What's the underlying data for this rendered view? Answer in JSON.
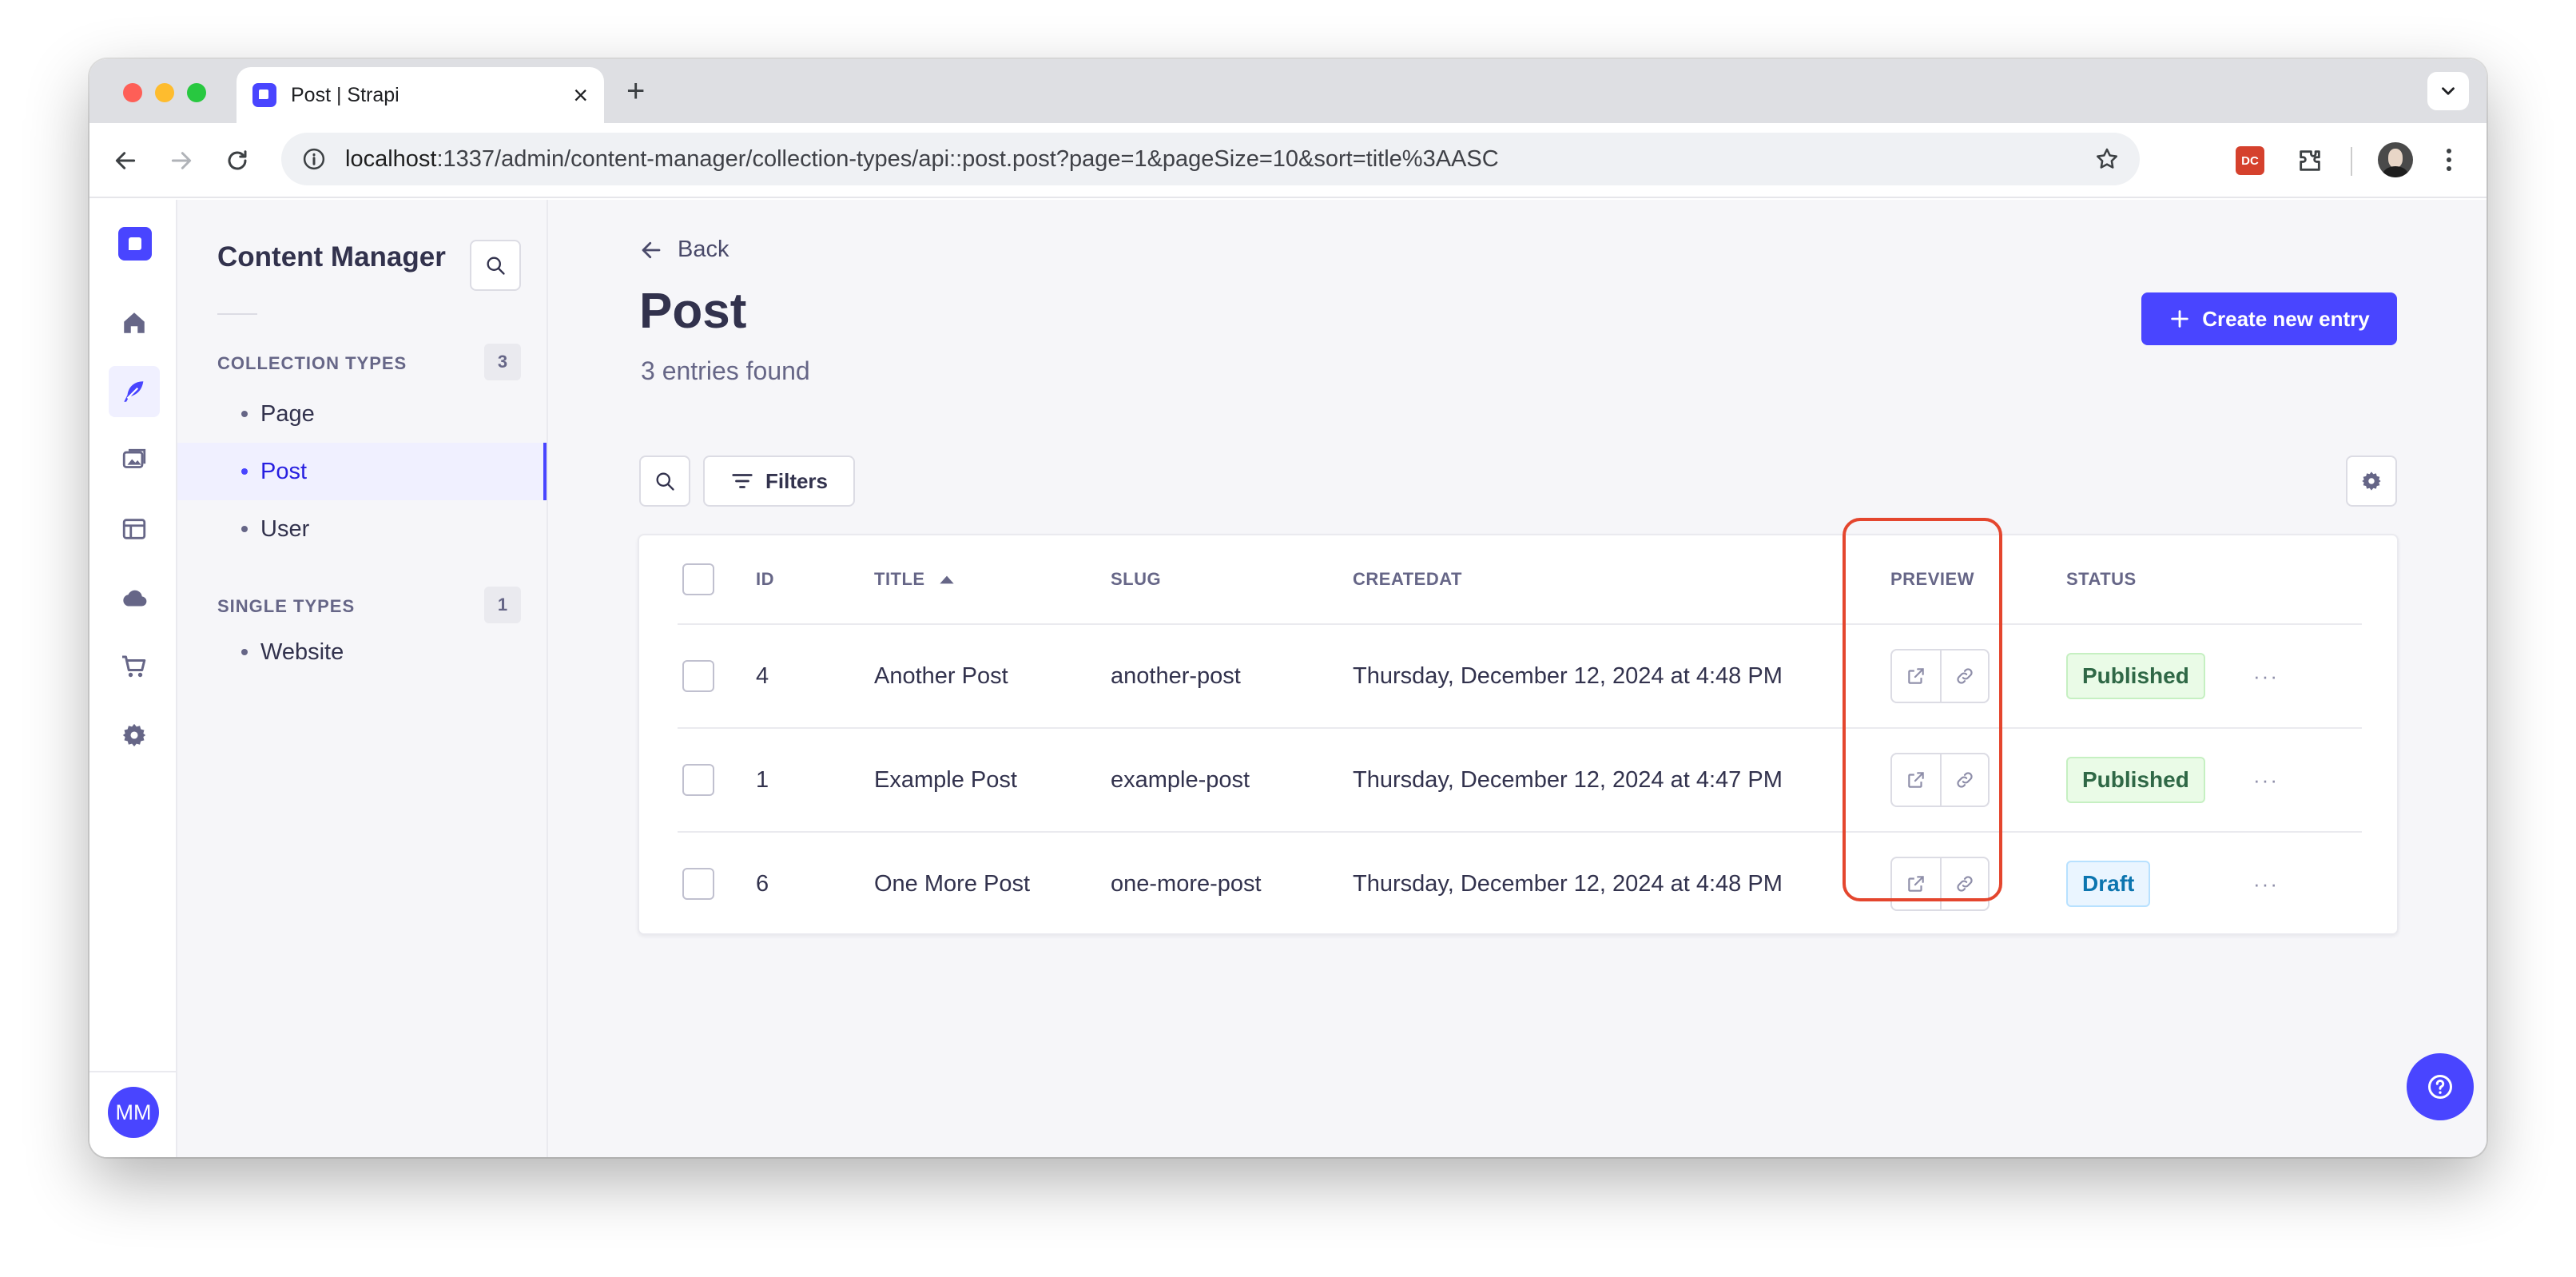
{
  "browser": {
    "tab_title": "Post | Strapi",
    "url_host": "localhost",
    "url_rest": ":1337/admin/content-manager/collection-types/api::post.post?page=1&pageSize=10&sort=title%3AASC",
    "extension_badge": "DC"
  },
  "rail": {
    "avatar_initials": "MM",
    "icons": [
      "home-icon",
      "feather-icon",
      "media-library-icon",
      "layout-icon",
      "cloud-icon",
      "cart-icon",
      "gear-icon"
    ]
  },
  "subnav": {
    "title": "Content Manager",
    "collection_types": {
      "label": "COLLECTION TYPES",
      "count": "3",
      "items": [
        "Page",
        "Post",
        "User"
      ],
      "active": "Post"
    },
    "single_types": {
      "label": "SINGLE TYPES",
      "count": "1",
      "items": [
        "Website"
      ]
    }
  },
  "header": {
    "back_label": "Back",
    "title": "Post",
    "subtitle": "3 entries found",
    "create_label": "Create new entry"
  },
  "toolbar": {
    "filters_label": "Filters"
  },
  "table": {
    "columns": {
      "id": "ID",
      "title": "TITLE",
      "slug": "SLUG",
      "createdat": "CREATEDAT",
      "preview": "PREVIEW",
      "status": "STATUS"
    },
    "sort": {
      "column": "title",
      "direction": "asc"
    },
    "rows": [
      {
        "id": "4",
        "title": "Another Post",
        "slug": "another-post",
        "createdAt": "Thursday, December 12, 2024 at 4:48 PM",
        "status": "Published"
      },
      {
        "id": "1",
        "title": "Example Post",
        "slug": "example-post",
        "createdAt": "Thursday, December 12, 2024 at 4:47 PM",
        "status": "Published"
      },
      {
        "id": "6",
        "title": "One More Post",
        "slug": "one-more-post",
        "createdAt": "Thursday, December 12, 2024 at 4:48 PM",
        "status": "Draft"
      }
    ],
    "more_glyph": "···"
  },
  "colors": {
    "primary": "#4945ff",
    "highlight": "#e4462e",
    "published_text": "#2f6846",
    "draft_text": "#0c75af"
  }
}
